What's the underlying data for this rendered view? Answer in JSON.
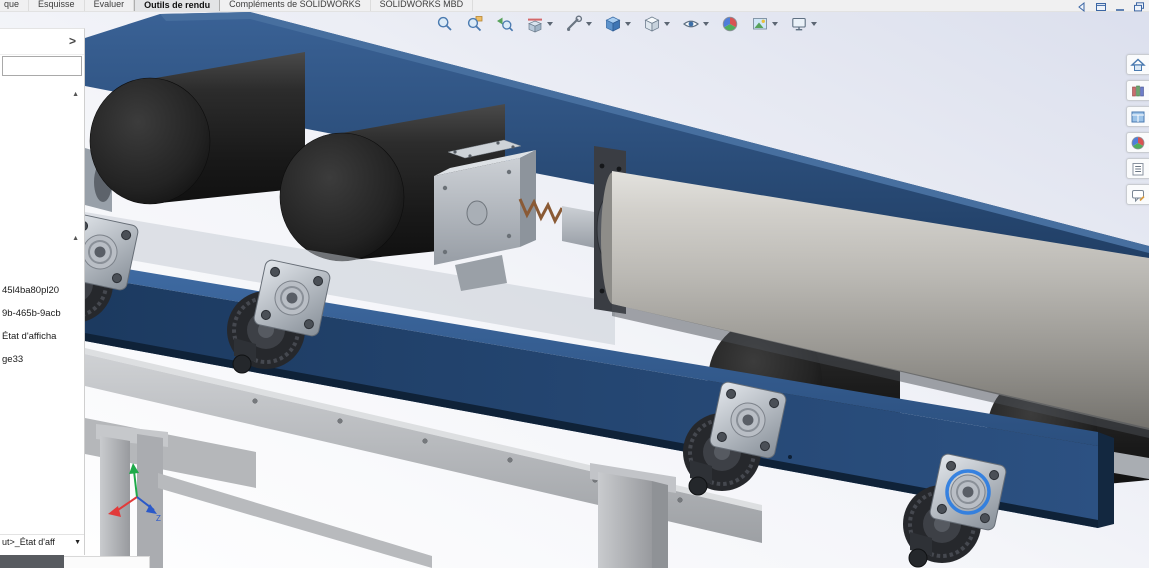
{
  "tabbar": {
    "tabs": [
      {
        "label": "que"
      },
      {
        "label": "Esquisse"
      },
      {
        "label": "Évaluer"
      },
      {
        "label": "Outils de rendu"
      },
      {
        "label": "Compléments de SOLIDWORKS"
      },
      {
        "label": "SOLIDWORKS MBD"
      }
    ],
    "active_tab": "Outils de rendu"
  },
  "window_controls": {
    "icons": [
      "back",
      "window",
      "minimize",
      "restore"
    ]
  },
  "headsup_toolbar": {
    "icons": [
      "zoom-fit",
      "zoom-area",
      "previous-view",
      "section-view",
      "measure",
      "view-orientation",
      "display-style",
      "hide-show-items",
      "edit-appearance",
      "apply-scene",
      "view-settings"
    ]
  },
  "taskpane": {
    "icons": [
      "resources-home",
      "design-library",
      "view-palette",
      "appearances",
      "custom-properties",
      "forum"
    ]
  },
  "feature_panel": {
    "expand_arrow": ">",
    "scroll_up_glyph": "▲",
    "tree_items": [
      "45l4ba80pl20",
      "9b-465b-9acb",
      "État d'afficha",
      "ge33"
    ],
    "config_bar": {
      "label": "ut>_État d'aff",
      "dropdown_glyph": "▼"
    }
  },
  "viewport": {
    "scene": "conveyor-roller-assembly-3d-model",
    "triad_label": "Z",
    "selection_highlight_color": "#2e7de0",
    "colors": {
      "frame_blue": "#1e3e66",
      "roller_gray": "#b9b7b2",
      "drum_black": "#1f1f1f",
      "steel_gray": "#b7b9bc",
      "background_top_right": "#dbdfed"
    }
  }
}
